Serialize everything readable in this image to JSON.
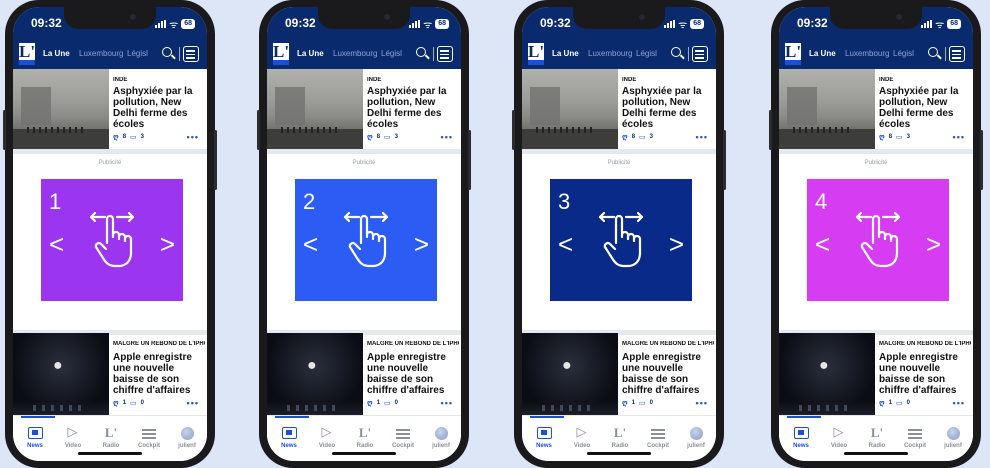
{
  "status": {
    "time": "09:32",
    "battery": "68"
  },
  "nav": {
    "logo": "L'",
    "tabs": [
      "La Une",
      "Luxembourg",
      "Législ"
    ]
  },
  "article1": {
    "kicker": "INDE",
    "headline": "Asphyxiée par la pollution, New Delhi ferme des écoles",
    "likes": "8",
    "comments": "3",
    "more": "•••"
  },
  "ad_label": "Publicité",
  "ads": [
    {
      "number": "1",
      "color": "#9b35f0"
    },
    {
      "number": "2",
      "color": "#2d5cf5"
    },
    {
      "number": "3",
      "color": "#0a2a8a"
    },
    {
      "number": "4",
      "color": "#d63df2"
    }
  ],
  "article2": {
    "kicker": "MALGRÉ UN REBOND DE L'IPHONE",
    "headline": "Apple enregistre une nouvelle baisse de son chiffre d'affaires",
    "likes": "1",
    "comments": "0",
    "more": "•••"
  },
  "tabbar": {
    "items": [
      "News",
      "Video",
      "Radio",
      "Cockpit",
      "julienf"
    ]
  },
  "icons": {
    "like": "like-icon",
    "comment": "comment-icon",
    "search": "search-icon",
    "filter": "filter-icon",
    "swipe": "swipe-hand-icon"
  }
}
